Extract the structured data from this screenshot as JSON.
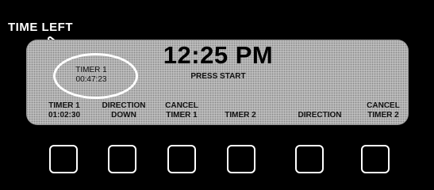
{
  "callout": {
    "label": "TIME LEFT"
  },
  "display": {
    "clock": "12:25 PM",
    "hint": "PRESS START",
    "timer1_status": {
      "name": "TIMER 1",
      "time": "00:47:23"
    },
    "soft_labels": [
      {
        "line1": "TIMER 1",
        "line2": "01:02:30"
      },
      {
        "line1": "DIRECTION",
        "line2": "DOWN"
      },
      {
        "line1": "CANCEL",
        "line2": "TIMER 1"
      },
      {
        "line1": "",
        "line2": "TIMER 2"
      },
      {
        "line1": "",
        "line2": "DIRECTION"
      },
      {
        "line1": "CANCEL",
        "line2": "TIMER 2"
      }
    ]
  }
}
